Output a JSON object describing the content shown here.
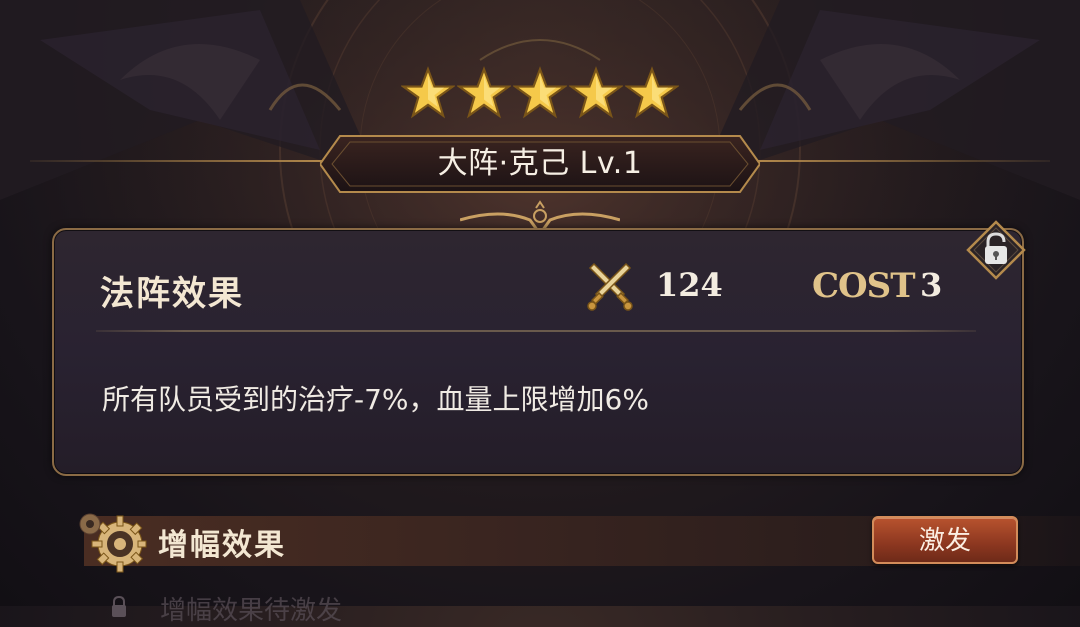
{
  "formation": {
    "star_count": 5,
    "title": "大阵·克己 Lv.1"
  },
  "panel": {
    "section_title": "法阵效果",
    "power_value": "124",
    "cost_label": "COST",
    "cost_value": "3",
    "effect_description": "所有队员受到的治疗-7%，血量上限增加6%"
  },
  "amplify": {
    "section_title": "增幅效果",
    "activate_label": "激发",
    "status_text": "增幅效果待激发"
  },
  "icons": {
    "star": "star-icon",
    "power": "crossed-swords-icon",
    "lock": "padlock-icon",
    "gear": "gear-icon"
  },
  "colors": {
    "gold": "#e0c38a",
    "button": "#8c3720",
    "panel_border": "#8b6b45"
  }
}
